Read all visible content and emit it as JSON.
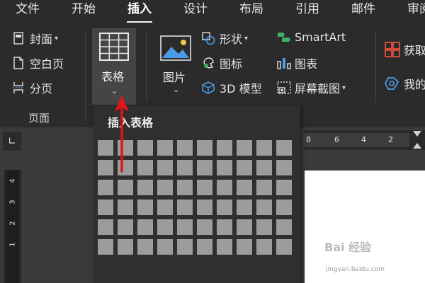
{
  "menu": {
    "tabs": [
      {
        "label": "文件"
      },
      {
        "label": "开始"
      },
      {
        "label": "插入"
      },
      {
        "label": "设计"
      },
      {
        "label": "布局"
      },
      {
        "label": "引用"
      },
      {
        "label": "邮件"
      },
      {
        "label": "审阅"
      }
    ],
    "active_tab": "插入"
  },
  "ribbon": {
    "pages_group": {
      "cover": "封面",
      "blank_page": "空白页",
      "page_break": "分页",
      "group_label": "页面"
    },
    "table_button": {
      "label": "表格"
    },
    "picture_button": {
      "label": "图片"
    },
    "shapes": "形状",
    "icons": "图标",
    "model3d": "3D 模型",
    "smartart": "SmartArt",
    "chart": "图表",
    "screenshot": "屏幕截图",
    "get_addins": "获取",
    "my_addins": "我的"
  },
  "dropdown": {
    "title": "插入表格",
    "grid_cols": 10,
    "grid_rows": 6
  },
  "ruler": {
    "horizontal_labels": [
      "8",
      "6",
      "4",
      "2"
    ],
    "vertical_labels": [
      "4",
      "3",
      "2",
      "1"
    ]
  },
  "watermark": {
    "brand": "Bai 经验",
    "site": "jingyan.baidu.com"
  },
  "colors": {
    "background": "#2b2b2b",
    "ribbon_button_active": "#454545",
    "grid_cell": "#9c9c9c",
    "arrow": "#e0141e",
    "icon_blue": "#4a9be8",
    "icon_red": "#e0503a",
    "icon_green": "#3fae6a"
  }
}
